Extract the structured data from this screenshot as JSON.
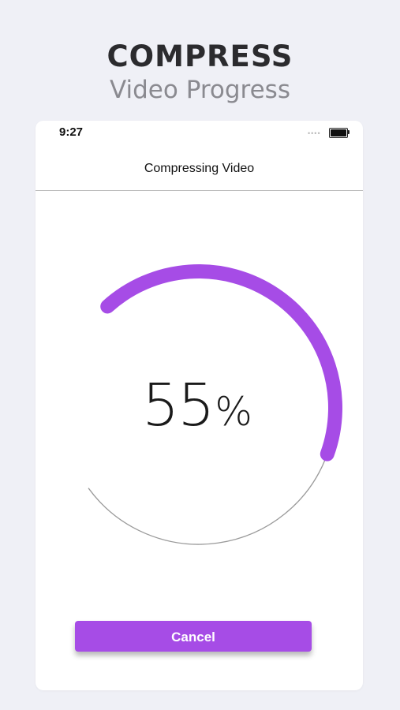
{
  "promo": {
    "title": "COMPRESS",
    "subtitle": "Video Progress"
  },
  "status_bar": {
    "time": "9:27",
    "signal_dots": "••••",
    "signal_icon": "signal-dots-icon",
    "battery_icon": "battery-icon"
  },
  "nav": {
    "title": "Compressing Video"
  },
  "progress": {
    "value_percent": 55,
    "number": "55",
    "sign": "%",
    "accent_color": "#a64ce6",
    "track_color": "#9a9a9a"
  },
  "actions": {
    "cancel_label": "Cancel"
  },
  "colors": {
    "background": "#eff0f6",
    "card": "#ffffff",
    "button": "#a64ce6"
  }
}
